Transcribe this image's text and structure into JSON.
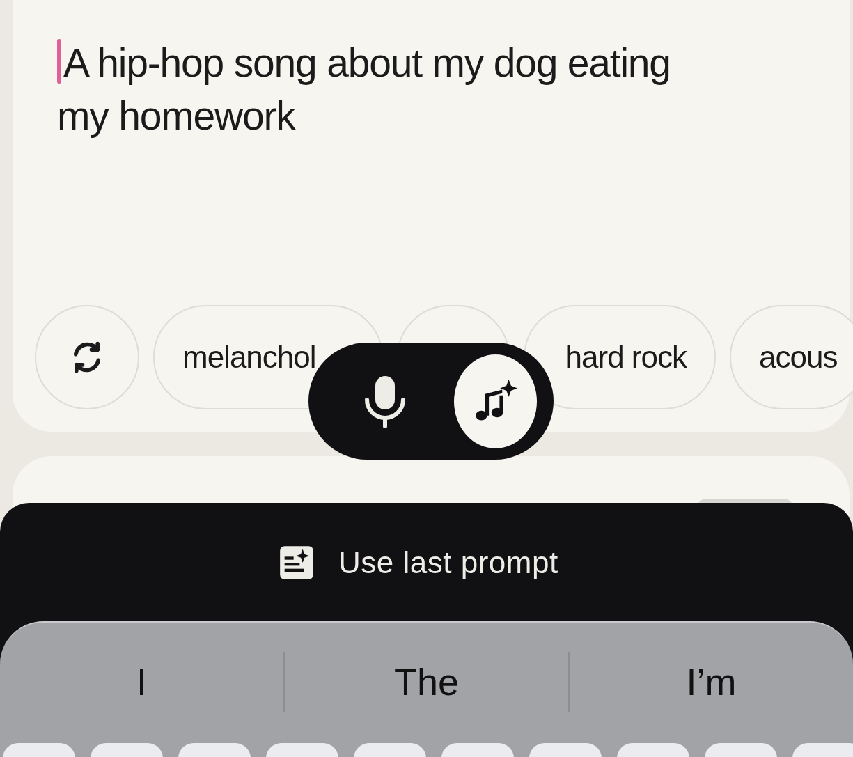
{
  "prompt": {
    "value": "A hip-hop song about my dog eating my homework"
  },
  "chips": [
    {
      "kind": "refresh"
    },
    {
      "kind": "text",
      "label": "melanchol"
    },
    {
      "kind": "blank"
    },
    {
      "kind": "text",
      "label": "hard rock"
    },
    {
      "kind": "text",
      "label": "acous"
    }
  ],
  "mode_toggle": [
    {
      "kind": "mic",
      "selected": false
    },
    {
      "kind": "music",
      "selected": true
    }
  ],
  "last_prompt": {
    "label": "Use last prompt"
  },
  "keyboard": {
    "suggestions": [
      "I",
      "The",
      "I’m"
    ]
  }
}
